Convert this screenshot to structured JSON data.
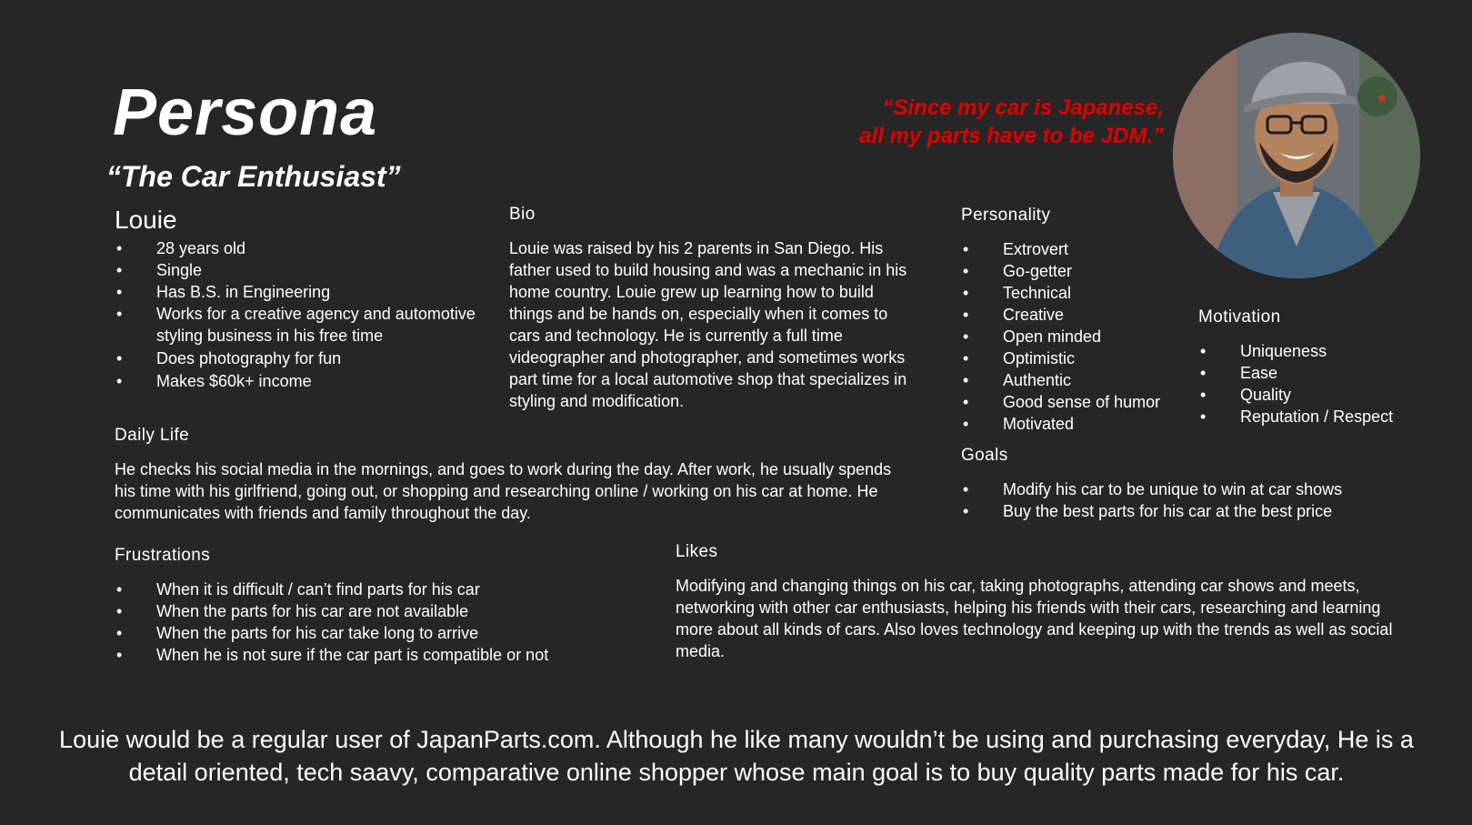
{
  "header": {
    "title": "Persona",
    "subtitle": "“The Car Enthusiast”",
    "quote_line1": "“Since my car is Japanese,",
    "quote_line2": "all my parts have to be JDM.”"
  },
  "profile": {
    "name": "Louie",
    "facts": [
      "28 years old",
      "Single",
      "Has B.S. in Engineering",
      "Works for a creative agency and automotive styling business in his free time",
      "Does photography for fun",
      "Makes $60k+ income"
    ]
  },
  "bio": {
    "heading": "Bio",
    "text": "Louie was raised by his 2 parents in San Diego. His father used to build housing and was a mechanic in his home country. Louie grew up learning how to build things and be hands on, especially when it comes to cars and technology. He is currently a full time videographer and photographer, and sometimes works part time for a local automotive shop that specializes in styling and modification."
  },
  "personality": {
    "heading": "Personality",
    "items": [
      "Extrovert",
      "Go-getter",
      "Technical",
      "Creative",
      "Open minded",
      "Optimistic",
      "Authentic",
      "Good sense of humor",
      "Motivated"
    ]
  },
  "motivation": {
    "heading": "Motivation",
    "items": [
      "Uniqueness",
      "Ease",
      "Quality",
      "Reputation / Respect"
    ]
  },
  "daily_life": {
    "heading": "Daily Life",
    "text": "He checks his social media in the mornings, and goes to work during the day. After work, he usually spends his time with his girlfriend, going out, or shopping and researching online / working on his car at home. He communicates with friends and family throughout the day."
  },
  "goals": {
    "heading": "Goals",
    "items": [
      "Modify his car to be unique to win at car shows",
      "Buy the best parts for his car at the best price"
    ]
  },
  "frustrations": {
    "heading": "Frustrations",
    "items": [
      "When it is difficult / can’t find parts for his car",
      "When the parts for his car are not available",
      "When the parts for his car take long to arrive",
      "When he is not sure if the car part is compatible or not"
    ]
  },
  "likes": {
    "heading": "Likes",
    "text": "Modifying and changing things on his car, taking photographs, attending car shows and meets, networking with other car enthusiasts, helping his friends with their cars, researching and learning more about all kinds of cars. Also loves technology and keeping up with the trends as well as social media."
  },
  "summary": "Louie would be a regular user of JapanParts.com. Although he like many wouldn’t be using and purchasing everyday, He is a detail oriented, tech saavy, comparative online shopper whose main goal is to buy quality parts made for his car.",
  "colors": {
    "background": "#262626",
    "text": "#ffffff",
    "quote": "#e00000"
  }
}
